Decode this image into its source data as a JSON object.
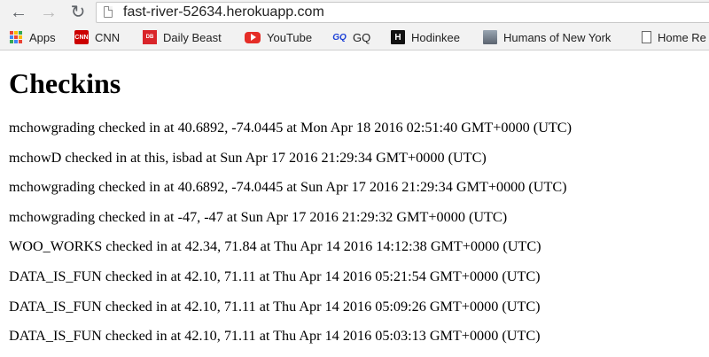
{
  "browser": {
    "url": "fast-river-52634.herokuapp.com",
    "nav": {
      "back_glyph": "←",
      "forward_glyph": "→",
      "reload_glyph": "↻"
    },
    "bookmarks": [
      {
        "label": "Apps",
        "icon": "apps-grid-icon"
      },
      {
        "label": "CNN",
        "icon": "cnn-icon"
      },
      {
        "label": "Daily Beast",
        "icon": "daily-beast-icon"
      },
      {
        "label": "YouTube",
        "icon": "youtube-icon"
      },
      {
        "label": "GQ",
        "icon": "gq-icon"
      },
      {
        "label": "Hodinkee",
        "icon": "hodinkee-icon"
      },
      {
        "label": "Humans of New York",
        "icon": "humans-of-new-york-icon"
      },
      {
        "label": "Home Re",
        "icon": "document-icon"
      }
    ],
    "icon_text": {
      "cnn": "CNN",
      "daily_beast": "DB",
      "gq": "GQ",
      "hodinkee": "H"
    },
    "colors": {
      "apps_grid": [
        "#ea4335",
        "#fbbc05",
        "#34a853",
        "#4285f4",
        "#ea4335",
        "#fbbc05",
        "#34a853",
        "#4285f4",
        "#ea4335"
      ]
    }
  },
  "page": {
    "title": "Checkins",
    "checkins": [
      "mchowgrading checked in at 40.6892, -74.0445 at Mon Apr 18 2016 02:51:40 GMT+0000 (UTC)",
      "mchowD checked in at this, isbad at Sun Apr 17 2016 21:29:34 GMT+0000 (UTC)",
      "mchowgrading checked in at 40.6892, -74.0445 at Sun Apr 17 2016 21:29:34 GMT+0000 (UTC)",
      "mchowgrading checked in at -47, -47 at Sun Apr 17 2016 21:29:32 GMT+0000 (UTC)",
      "WOO_WORKS checked in at 42.34, 71.84 at Thu Apr 14 2016 14:12:38 GMT+0000 (UTC)",
      "DATA_IS_FUN checked in at 42.10, 71.11 at Thu Apr 14 2016 05:21:54 GMT+0000 (UTC)",
      "DATA_IS_FUN checked in at 42.10, 71.11 at Thu Apr 14 2016 05:09:26 GMT+0000 (UTC)",
      "DATA_IS_FUN checked in at 42.10, 71.11 at Thu Apr 14 2016 05:03:13 GMT+0000 (UTC)"
    ]
  }
}
